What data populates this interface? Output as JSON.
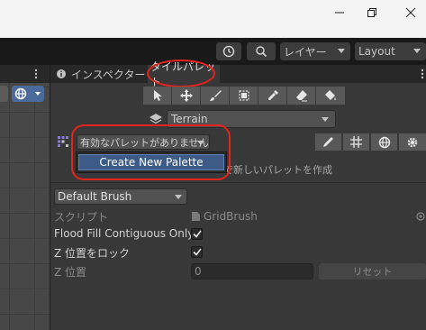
{
  "toolbar": {
    "layers_label": "レイヤー",
    "layout_label": "Layout"
  },
  "tabs": {
    "inspector": "インスペクター",
    "tile_palette": "タイルパレット"
  },
  "palette": {
    "tilemap_target": "Terrain",
    "palette_dropdown": "有効なパレットがありません",
    "menu_create": "Create New Palette",
    "create_hint": "で新しいパレットを作成"
  },
  "brush": {
    "dropdown": "Default Brush",
    "script_label": "スクリプト",
    "script_value": "GridBrush",
    "flood_fill_label": "Flood Fill Contiguous Only",
    "z_lock_label": "Z 位置をロック",
    "z_position_label": "Z 位置",
    "z_position_value": "0",
    "reset_label": "リセット"
  },
  "colors": {
    "highlight": "#e2241a",
    "menu_selected": "#3d5b86"
  }
}
